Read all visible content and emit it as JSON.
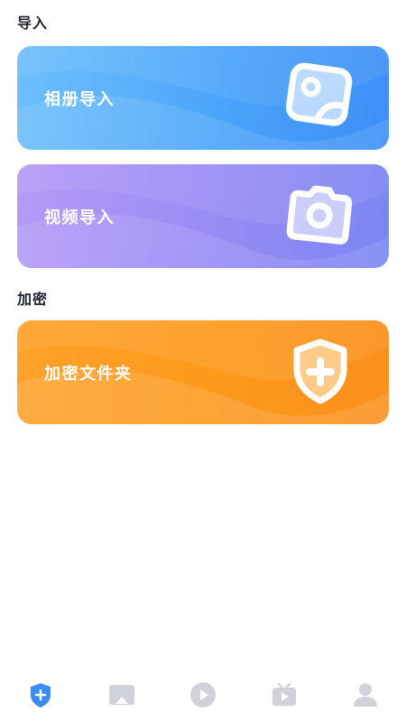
{
  "sections": {
    "import_title": "导入",
    "encrypt_title": "加密"
  },
  "cards": {
    "album_import": {
      "label": "相册导入",
      "icon": "photo-icon"
    },
    "video_import": {
      "label": "视频导入",
      "icon": "camera-icon"
    },
    "encrypted_folder": {
      "label": "加密文件夹",
      "icon": "shield-plus-icon"
    }
  },
  "tabbar": {
    "items": [
      {
        "icon": "shield-plus-icon",
        "active": true
      },
      {
        "icon": "picture-icon",
        "active": false
      },
      {
        "icon": "play-icon",
        "active": false
      },
      {
        "icon": "tv-play-icon",
        "active": false
      },
      {
        "icon": "user-icon",
        "active": false
      }
    ],
    "active_color": "#3b8cf5",
    "inactive_color": "#cfd2d8"
  },
  "colors": {
    "album_card": "#4aa4fa",
    "video_card": "#9a8cf5",
    "encrypt_card": "#fd9a1c"
  }
}
